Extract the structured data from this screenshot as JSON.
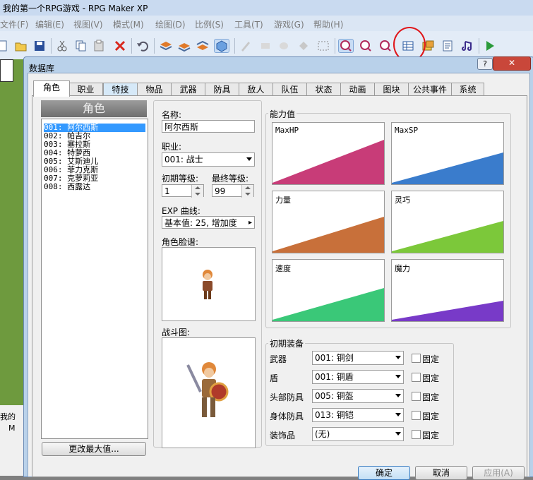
{
  "window": {
    "title": "我的第一个RPG游戏 - RPG Maker XP"
  },
  "menu": [
    "文件(F)",
    "编辑(E)",
    "视图(V)",
    "模式(M)",
    "绘图(D)",
    "比例(S)",
    "工具(T)",
    "游戏(G)",
    "帮助(H)"
  ],
  "dialog": {
    "title": "数据库",
    "help": "?",
    "close": "✕"
  },
  "tabs": [
    "角色",
    "职业",
    "特技",
    "物品",
    "武器",
    "防具",
    "敌人",
    "队伍",
    "状态",
    "动画",
    "图块",
    "公共事件",
    "系统"
  ],
  "actor_panel": {
    "heading": "角色",
    "actors": [
      "001: 阿尔西斯",
      "002: 帕吉尔",
      "003: 塞拉斯",
      "004: 特萝西",
      "005: 艾斯迪儿",
      "006: 菲力克斯",
      "007: 克萝莉亚",
      "008: 西露达"
    ],
    "change_max_button": "更改最大值..."
  },
  "form": {
    "name_label": "名称:",
    "name_value": "阿尔西斯",
    "class_label": "职业:",
    "class_value": "001: 战士",
    "initial_level_label": "初期等级:",
    "initial_level_value": "1",
    "final_level_label": "最终等级:",
    "final_level_value": "99",
    "exp_label": "EXP 曲线:",
    "exp_value": "基本值: 25, 增加度",
    "face_label": "角色脸谱:",
    "battler_label": "战斗图:"
  },
  "stats": {
    "title": "能力值",
    "items": [
      {
        "label": "MaxHP",
        "color": "#c83c78"
      },
      {
        "label": "MaxSP",
        "color": "#3a7ccc"
      },
      {
        "label": "力量",
        "color": "#c8703a"
      },
      {
        "label": "灵巧",
        "color": "#7cc83a"
      },
      {
        "label": "速度",
        "color": "#3ac878"
      },
      {
        "label": "魔力",
        "color": "#783ac8"
      }
    ]
  },
  "equipment": {
    "title": "初期装备",
    "fixed_label": "固定",
    "slots": [
      {
        "label": "武器",
        "value": "001: 铜剑"
      },
      {
        "label": "盾",
        "value": "001: 铜盾"
      },
      {
        "label": "头部防具",
        "value": "005: 铜盔"
      },
      {
        "label": "身体防具",
        "value": "013: 铜铠"
      },
      {
        "label": "装饰品",
        "value": "(无)"
      }
    ]
  },
  "footer": {
    "ok": "确定",
    "cancel": "取消",
    "apply": "应用(A)"
  },
  "left_panel": {
    "text1": "我的",
    "text2": "M"
  }
}
